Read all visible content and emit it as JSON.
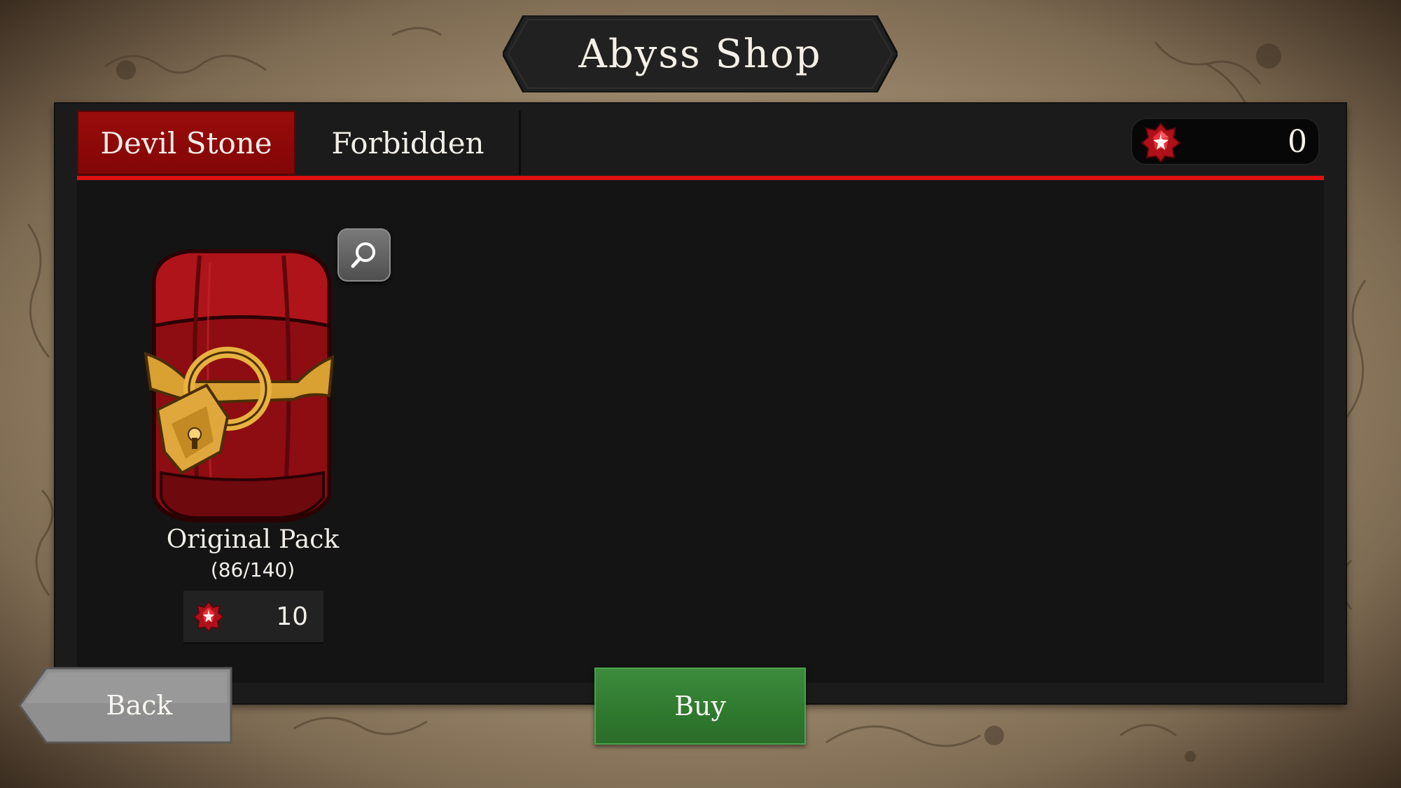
{
  "header": {
    "title": "Abyss Shop"
  },
  "tabs": [
    {
      "label": "Devil Stone",
      "active": true
    },
    {
      "label": "Forbidden",
      "active": false
    }
  ],
  "currency": {
    "icon": "devil-stone-gem-icon",
    "value": "0"
  },
  "items": [
    {
      "name": "Original Pack",
      "count": "(86/140)",
      "price_icon": "devil-stone-gem-icon",
      "price": "10",
      "zoom_icon": "magnifier-icon"
    }
  ],
  "buttons": {
    "back_label": "Back",
    "buy_label": "Buy"
  },
  "colors": {
    "active_tab": "#8e0909",
    "tab_underline": "#e01010",
    "buy_button": "#2f7a2f",
    "panel": "#1c1b1b"
  }
}
